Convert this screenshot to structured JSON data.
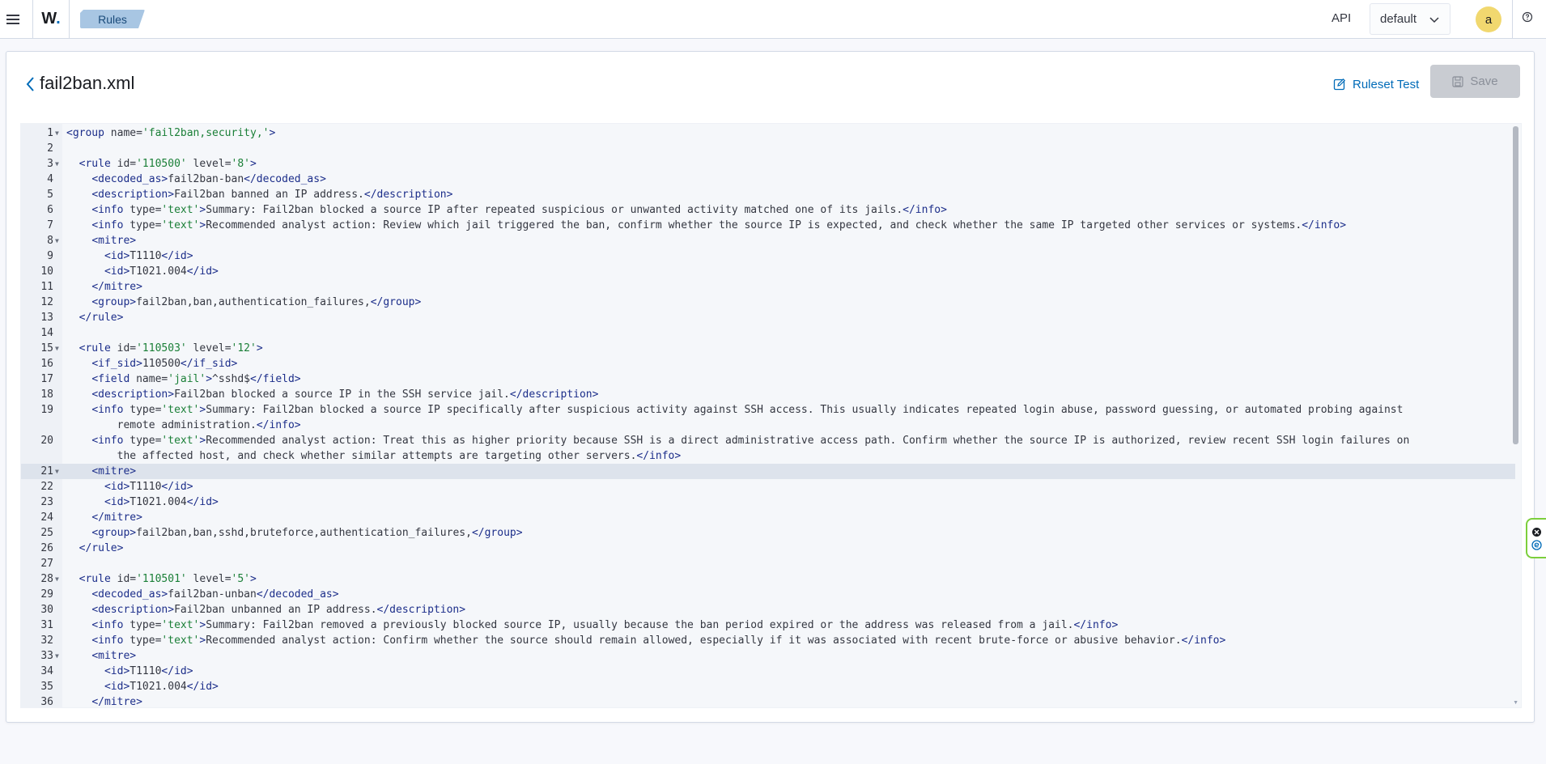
{
  "header": {
    "app_logo": "W.",
    "logo_letter": "W",
    "logo_dot": ".",
    "breadcrumb": "Rules",
    "api_label": "API",
    "env_selected": "default",
    "avatar_letter": "a"
  },
  "page": {
    "file_title": "fail2ban.xml",
    "ruleset_test_label": "Ruleset Test",
    "save_label": "Save"
  },
  "colors": {
    "accent": "#006bb8",
    "tag": "#1c2e8a",
    "value": "#1a7f37",
    "avatar_bg": "#f1d86f",
    "breadcrumb_bg": "#a8c6e3",
    "widget_border": "#7ccf3c"
  },
  "icons": {
    "menu": "hamburger-menu-icon",
    "chevron": "chevron-down-icon",
    "help": "help-circle-icon",
    "back": "chevron-left-icon",
    "ruleset_test": "edit-test-icon",
    "save": "save-disk-icon"
  },
  "editor": {
    "active_line": 21,
    "lines": [
      {
        "n": "1",
        "fold": true,
        "tokens": [
          [
            "t",
            "<group "
          ],
          [
            "a",
            "name="
          ],
          [
            "v",
            "'fail2ban,security,'"
          ],
          [
            "t",
            ">"
          ]
        ]
      },
      {
        "n": "2",
        "fold": false,
        "tokens": []
      },
      {
        "n": "3",
        "fold": true,
        "tokens": [
          [
            "x",
            "  "
          ],
          [
            "t",
            "<rule "
          ],
          [
            "a",
            "id="
          ],
          [
            "v",
            "'110500'"
          ],
          [
            "a",
            " level="
          ],
          [
            "v",
            "'8'"
          ],
          [
            "t",
            ">"
          ]
        ]
      },
      {
        "n": "4",
        "fold": false,
        "tokens": [
          [
            "x",
            "    "
          ],
          [
            "t",
            "<decoded_as>"
          ],
          [
            "x",
            "fail2ban-ban"
          ],
          [
            "t",
            "</decoded_as>"
          ]
        ]
      },
      {
        "n": "5",
        "fold": false,
        "tokens": [
          [
            "x",
            "    "
          ],
          [
            "t",
            "<description>"
          ],
          [
            "x",
            "Fail2ban banned an IP address."
          ],
          [
            "t",
            "</description>"
          ]
        ]
      },
      {
        "n": "6",
        "fold": false,
        "tokens": [
          [
            "x",
            "    "
          ],
          [
            "t",
            "<info "
          ],
          [
            "a",
            "type="
          ],
          [
            "v",
            "'text'"
          ],
          [
            "t",
            ">"
          ],
          [
            "x",
            "Summary: Fail2ban blocked a source IP after repeated suspicious or unwanted activity matched one of its jails."
          ],
          [
            "t",
            "</info>"
          ]
        ]
      },
      {
        "n": "7",
        "fold": false,
        "tokens": [
          [
            "x",
            "    "
          ],
          [
            "t",
            "<info "
          ],
          [
            "a",
            "type="
          ],
          [
            "v",
            "'text'"
          ],
          [
            "t",
            ">"
          ],
          [
            "x",
            "Recommended analyst action: Review which jail triggered the ban, confirm whether the source IP is expected, and check whether the same IP targeted other services or systems."
          ],
          [
            "t",
            "</info>"
          ]
        ]
      },
      {
        "n": "8",
        "fold": true,
        "tokens": [
          [
            "x",
            "    "
          ],
          [
            "t",
            "<mitre>"
          ]
        ]
      },
      {
        "n": "9",
        "fold": false,
        "tokens": [
          [
            "x",
            "      "
          ],
          [
            "t",
            "<id>"
          ],
          [
            "x",
            "T1110"
          ],
          [
            "t",
            "</id>"
          ]
        ]
      },
      {
        "n": "10",
        "fold": false,
        "tokens": [
          [
            "x",
            "      "
          ],
          [
            "t",
            "<id>"
          ],
          [
            "x",
            "T1021.004"
          ],
          [
            "t",
            "</id>"
          ]
        ]
      },
      {
        "n": "11",
        "fold": false,
        "tokens": [
          [
            "x",
            "    "
          ],
          [
            "t",
            "</mitre>"
          ]
        ]
      },
      {
        "n": "12",
        "fold": false,
        "tokens": [
          [
            "x",
            "    "
          ],
          [
            "t",
            "<group>"
          ],
          [
            "x",
            "fail2ban,ban,authentication_failures,"
          ],
          [
            "t",
            "</group>"
          ]
        ]
      },
      {
        "n": "13",
        "fold": false,
        "tokens": [
          [
            "x",
            "  "
          ],
          [
            "t",
            "</rule>"
          ]
        ]
      },
      {
        "n": "14",
        "fold": false,
        "tokens": []
      },
      {
        "n": "15",
        "fold": true,
        "tokens": [
          [
            "x",
            "  "
          ],
          [
            "t",
            "<rule "
          ],
          [
            "a",
            "id="
          ],
          [
            "v",
            "'110503'"
          ],
          [
            "a",
            " level="
          ],
          [
            "v",
            "'12'"
          ],
          [
            "t",
            ">"
          ]
        ]
      },
      {
        "n": "16",
        "fold": false,
        "tokens": [
          [
            "x",
            "    "
          ],
          [
            "t",
            "<if_sid>"
          ],
          [
            "x",
            "110500"
          ],
          [
            "t",
            "</if_sid>"
          ]
        ]
      },
      {
        "n": "17",
        "fold": false,
        "tokens": [
          [
            "x",
            "    "
          ],
          [
            "t",
            "<field "
          ],
          [
            "a",
            "name="
          ],
          [
            "v",
            "'jail'"
          ],
          [
            "t",
            ">"
          ],
          [
            "x",
            "^sshd$"
          ],
          [
            "t",
            "</field>"
          ]
        ]
      },
      {
        "n": "18",
        "fold": false,
        "tokens": [
          [
            "x",
            "    "
          ],
          [
            "t",
            "<description>"
          ],
          [
            "x",
            "Fail2ban blocked a source IP in the SSH service jail."
          ],
          [
            "t",
            "</description>"
          ]
        ]
      },
      {
        "n": "19",
        "fold": false,
        "wrap": true,
        "tokens": [
          [
            "x",
            "    "
          ],
          [
            "t",
            "<info "
          ],
          [
            "a",
            "type="
          ],
          [
            "v",
            "'text'"
          ],
          [
            "t",
            ">"
          ],
          [
            "x",
            "Summary: Fail2ban blocked a source IP specifically after suspicious activity against SSH access. This usually indicates repeated login abuse, password guessing, or automated probing against\n        remote administration."
          ],
          [
            "t",
            "</info>"
          ]
        ]
      },
      {
        "n": "20",
        "fold": false,
        "wrap": true,
        "tokens": [
          [
            "x",
            "    "
          ],
          [
            "t",
            "<info "
          ],
          [
            "a",
            "type="
          ],
          [
            "v",
            "'text'"
          ],
          [
            "t",
            ">"
          ],
          [
            "x",
            "Recommended analyst action: Treat this as higher priority because SSH is a direct administrative access path. Confirm whether the source IP is authorized, review recent SSH login failures on\n        the affected host, and check whether similar attempts are targeting other servers."
          ],
          [
            "t",
            "</info>"
          ]
        ]
      },
      {
        "n": "21",
        "fold": true,
        "tokens": [
          [
            "x",
            "    "
          ],
          [
            "t",
            "<mitre>"
          ]
        ]
      },
      {
        "n": "22",
        "fold": false,
        "tokens": [
          [
            "x",
            "      "
          ],
          [
            "t",
            "<id>"
          ],
          [
            "x",
            "T1110"
          ],
          [
            "t",
            "</id>"
          ]
        ]
      },
      {
        "n": "23",
        "fold": false,
        "tokens": [
          [
            "x",
            "      "
          ],
          [
            "t",
            "<id>"
          ],
          [
            "x",
            "T1021.004"
          ],
          [
            "t",
            "</id>"
          ]
        ]
      },
      {
        "n": "24",
        "fold": false,
        "tokens": [
          [
            "x",
            "    "
          ],
          [
            "t",
            "</mitre>"
          ]
        ]
      },
      {
        "n": "25",
        "fold": false,
        "tokens": [
          [
            "x",
            "    "
          ],
          [
            "t",
            "<group>"
          ],
          [
            "x",
            "fail2ban,ban,sshd,bruteforce,authentication_failures,"
          ],
          [
            "t",
            "</group>"
          ]
        ]
      },
      {
        "n": "26",
        "fold": false,
        "tokens": [
          [
            "x",
            "  "
          ],
          [
            "t",
            "</rule>"
          ]
        ]
      },
      {
        "n": "27",
        "fold": false,
        "tokens": []
      },
      {
        "n": "28",
        "fold": true,
        "tokens": [
          [
            "x",
            "  "
          ],
          [
            "t",
            "<rule "
          ],
          [
            "a",
            "id="
          ],
          [
            "v",
            "'110501'"
          ],
          [
            "a",
            " level="
          ],
          [
            "v",
            "'5'"
          ],
          [
            "t",
            ">"
          ]
        ]
      },
      {
        "n": "29",
        "fold": false,
        "tokens": [
          [
            "x",
            "    "
          ],
          [
            "t",
            "<decoded_as>"
          ],
          [
            "x",
            "fail2ban-unban"
          ],
          [
            "t",
            "</decoded_as>"
          ]
        ]
      },
      {
        "n": "30",
        "fold": false,
        "tokens": [
          [
            "x",
            "    "
          ],
          [
            "t",
            "<description>"
          ],
          [
            "x",
            "Fail2ban unbanned an IP address."
          ],
          [
            "t",
            "</description>"
          ]
        ]
      },
      {
        "n": "31",
        "fold": false,
        "tokens": [
          [
            "x",
            "    "
          ],
          [
            "t",
            "<info "
          ],
          [
            "a",
            "type="
          ],
          [
            "v",
            "'text'"
          ],
          [
            "t",
            ">"
          ],
          [
            "x",
            "Summary: Fail2ban removed a previously blocked source IP, usually because the ban period expired or the address was released from a jail."
          ],
          [
            "t",
            "</info>"
          ]
        ]
      },
      {
        "n": "32",
        "fold": false,
        "tokens": [
          [
            "x",
            "    "
          ],
          [
            "t",
            "<info "
          ],
          [
            "a",
            "type="
          ],
          [
            "v",
            "'text'"
          ],
          [
            "t",
            ">"
          ],
          [
            "x",
            "Recommended analyst action: Confirm whether the source should remain allowed, especially if it was associated with recent brute-force or abusive behavior."
          ],
          [
            "t",
            "</info>"
          ]
        ]
      },
      {
        "n": "33",
        "fold": true,
        "tokens": [
          [
            "x",
            "    "
          ],
          [
            "t",
            "<mitre>"
          ]
        ]
      },
      {
        "n": "34",
        "fold": false,
        "tokens": [
          [
            "x",
            "      "
          ],
          [
            "t",
            "<id>"
          ],
          [
            "x",
            "T1110"
          ],
          [
            "t",
            "</id>"
          ]
        ]
      },
      {
        "n": "35",
        "fold": false,
        "tokens": [
          [
            "x",
            "      "
          ],
          [
            "t",
            "<id>"
          ],
          [
            "x",
            "T1021.004"
          ],
          [
            "t",
            "</id>"
          ]
        ]
      },
      {
        "n": "36",
        "fold": false,
        "tokens": [
          [
            "x",
            "    "
          ],
          [
            "t",
            "</mitre>"
          ]
        ]
      }
    ]
  }
}
